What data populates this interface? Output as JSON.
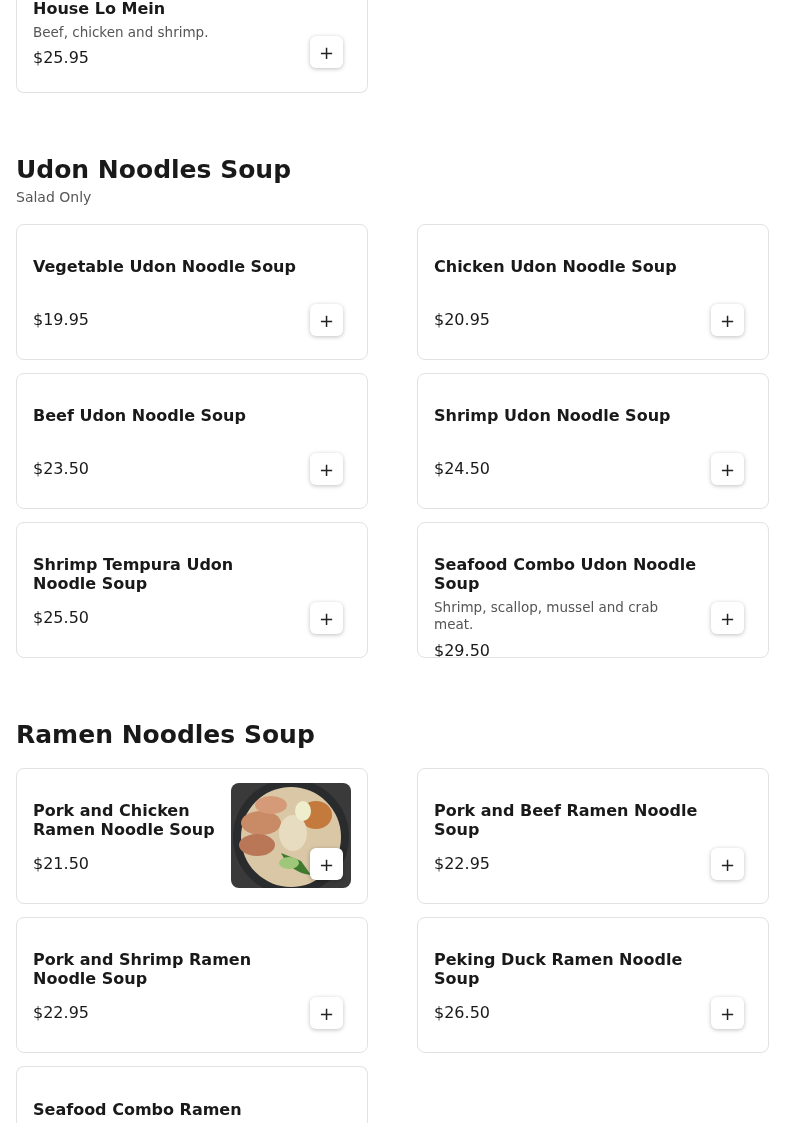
{
  "sections": [
    {
      "items": [
        {
          "name": "House Lo Mein",
          "description": "Beef, chicken and shrimp.",
          "price": "$25.95",
          "add": "+"
        }
      ]
    },
    {
      "title": "Udon Noodles Soup",
      "subtitle": "Salad Only",
      "items": [
        {
          "name": "Vegetable Udon Noodle Soup",
          "price": "$19.95",
          "add": "+"
        },
        {
          "name": "Chicken Udon Noodle Soup",
          "price": "$20.95",
          "add": "+"
        },
        {
          "name": "Beef Udon Noodle Soup",
          "price": "$23.50",
          "add": "+"
        },
        {
          "name": "Shrimp Udon Noodle Soup",
          "price": "$24.50",
          "add": "+"
        },
        {
          "name": "Shrimp Tempura Udon Noodle Soup",
          "price": "$25.50",
          "add": "+"
        },
        {
          "name": "Seafood Combo Udon Noodle Soup",
          "description": "Shrimp, scallop, mussel and crab meat.",
          "price": "$29.50",
          "add": "+"
        }
      ]
    },
    {
      "title": "Ramen Noodles Soup",
      "items": [
        {
          "name": "Pork and Chicken Ramen Noodle Soup",
          "price": "$21.50",
          "add": "+"
        },
        {
          "name": "Pork and Beef Ramen Noodle Soup",
          "price": "$22.95",
          "add": "+"
        },
        {
          "name": "Pork and Shrimp Ramen Noodle Soup",
          "price": "$22.95",
          "add": "+"
        },
        {
          "name": "Peking Duck Ramen Noodle Soup",
          "price": "$26.50",
          "add": "+"
        },
        {
          "name": "Seafood Combo Ramen"
        }
      ]
    }
  ]
}
